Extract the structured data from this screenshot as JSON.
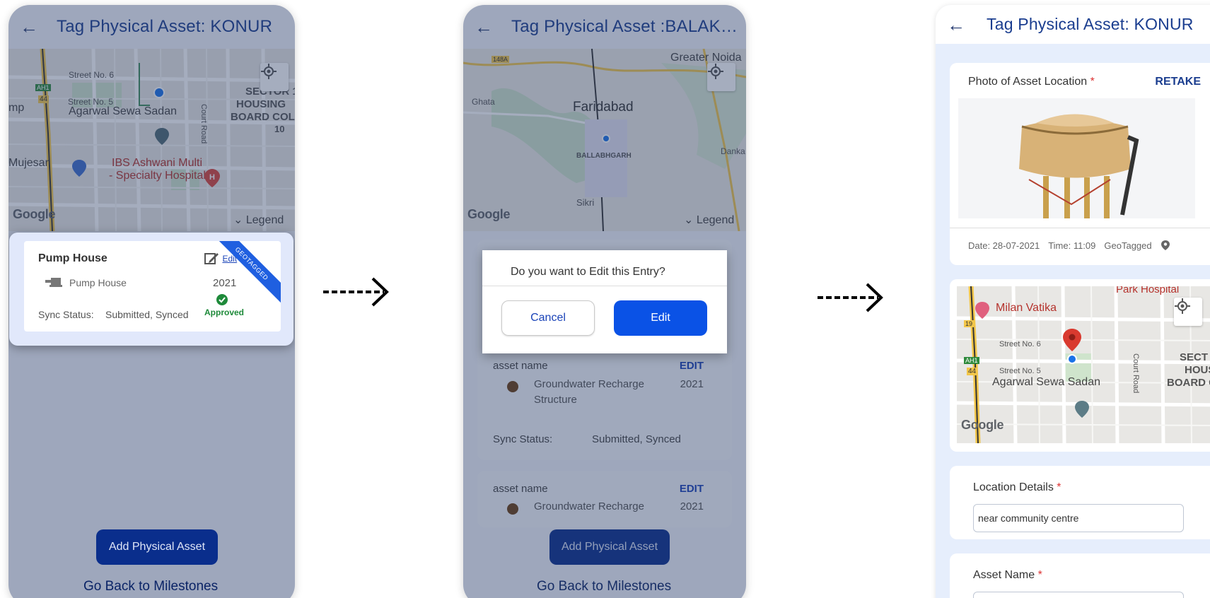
{
  "screen1": {
    "title": "Tag Physical Asset: KONUR",
    "map": {
      "labels": [
        "Street No. 6",
        "Street No. 5",
        "Agarwal Sewa Sadan",
        "SECTOR 1",
        "HOUSING",
        "BOARD COL",
        "10",
        "Court Road",
        "Mujesar",
        "IBS Ashwani Multi",
        "- Specialty Hospital",
        "mp"
      ],
      "road_badges": [
        "AH1",
        "44"
      ],
      "google": "Google",
      "legend": "Legend"
    },
    "card": {
      "name": "Pump House",
      "edit": "Edit",
      "type": "Pump House",
      "year": "2021",
      "sync_label": "Sync Status:",
      "sync_value": "Submitted, Synced",
      "status": "Approved",
      "ribbon": "GEOTAGGED"
    },
    "add_button": "Add Physical Asset",
    "back_link": "Go Back to Milestones"
  },
  "screen2": {
    "title": "Tag Physical Asset :BALAKA...",
    "map": {
      "labels": [
        "Greater Noida",
        "Faridabad",
        "BALLABHGARH",
        "Ghata",
        "Sikri",
        "Danka"
      ],
      "road_badges": [
        "148A"
      ],
      "google": "Google",
      "legend": "Legend"
    },
    "dialog": {
      "question": "Do you want to Edit this Entry?",
      "cancel": "Cancel",
      "edit": "Edit"
    },
    "cards": [
      {
        "name": "asset name",
        "edit": "EDIT",
        "type": "Groundwater Recharge Structure",
        "year": "2021",
        "sync_label": "Sync Status:",
        "sync_value": "Submitted, Synced"
      },
      {
        "name": "asset name",
        "edit": "EDIT",
        "type": "Groundwater Recharge",
        "year": "2021"
      }
    ],
    "add_button": "Add Physical Asset",
    "back_link": "Go Back to Milestones"
  },
  "screen3": {
    "title": "Tag Physical Asset: KONUR",
    "photo_section": {
      "label": "Photo of Asset Location",
      "required": "*",
      "retake": "RETAKE",
      "date": "Date: 28-07-2021",
      "time": "Time: 11:09",
      "geotag": "GeoTagged"
    },
    "map": {
      "labels": [
        "Milan Vatika",
        "Park Hospital",
        "Street No. 6",
        "Street No. 5",
        "Agarwal Sewa Sadan",
        "Court Road",
        "SECT",
        "HOUS",
        "BOARD C"
      ],
      "road_badges": [
        "19",
        "AH1",
        "44"
      ],
      "google": "Google"
    },
    "location": {
      "label": "Location Details",
      "required": "*",
      "value": "near community centre"
    },
    "asset_name": {
      "label": "Asset Name",
      "required": "*"
    }
  },
  "colors": {
    "brand_blue": "#1a3d8f",
    "primary_button": "#0a52e6",
    "approved_green": "#1e8a3a",
    "ribbon_blue": "#1f5fe0"
  }
}
